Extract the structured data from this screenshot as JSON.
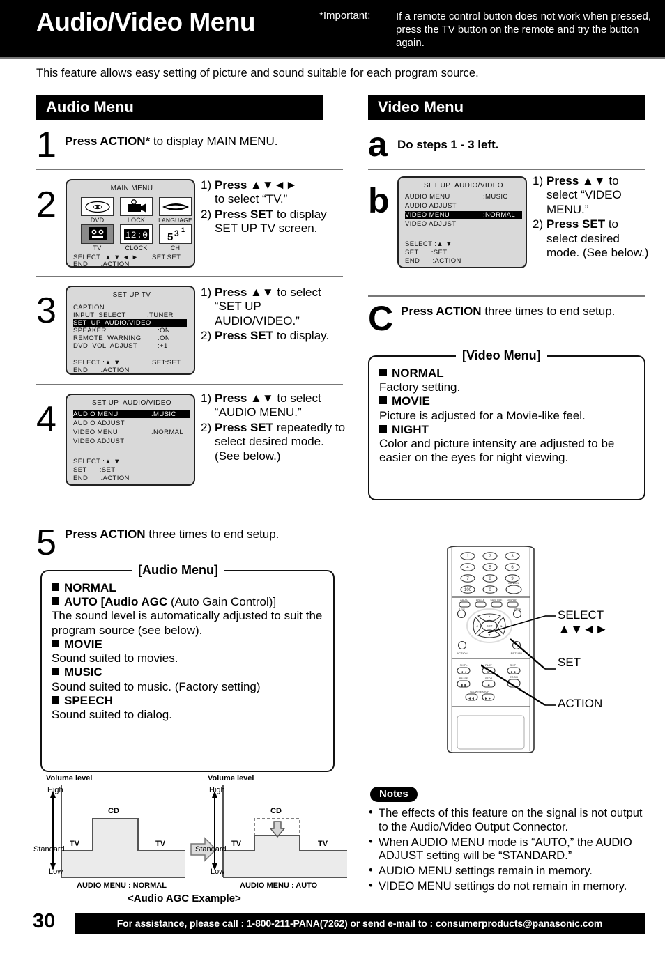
{
  "header": {
    "title": "Audio/Video Menu",
    "important_label": "*Important:",
    "important_text": "If a remote control button does not work when pressed, press the TV button on the remote and try the button again."
  },
  "intro": "This feature allows easy setting of picture and sound suitable for each program source.",
  "audio_section": {
    "bar_title": "Audio Menu",
    "step1": {
      "num": "1",
      "text_bold": "Press ACTION*",
      "text_rest": " to display MAIN MENU."
    },
    "step2": {
      "num": "2",
      "items": [
        {
          "marker": "1)",
          "bold": "Press ▲▼◄►",
          "rest": "to select “TV.”"
        },
        {
          "marker": "2)",
          "bold": "Press SET",
          "rest": " to display SET UP TV screen."
        }
      ],
      "osd": {
        "title": "MAIN MENU",
        "tiles": [
          {
            "label": "DVD",
            "icon": "disc-icon",
            "selected": false
          },
          {
            "label": "LOCK",
            "icon": "camcorder-icon",
            "selected": false
          },
          {
            "label": "LANGUAGE",
            "icon": "lips-icon",
            "selected": false
          },
          {
            "label": "TV",
            "icon": "tv-icon",
            "selected": true
          },
          {
            "label": "CLOCK",
            "icon": "clock-icon",
            "selected": false
          },
          {
            "label": "CH",
            "icon": "channel-icon",
            "selected": false
          }
        ],
        "footer_select": "SELECT :▲ ▼ ◄ ►",
        "footer_set": "SET:SET",
        "footer_end": "END      :ACTION"
      }
    },
    "step3": {
      "num": "3",
      "items": [
        {
          "marker": "1)",
          "bold": "Press ▲▼",
          "rest": " to select “SET UP AUDIO/VIDEO.”"
        },
        {
          "marker": "2)",
          "bold": "Press SET",
          "rest": " to display."
        }
      ],
      "osd": {
        "title": "SET UP TV",
        "rows": [
          {
            "label": "CAPTION",
            "value": "",
            "highlighted": false
          },
          {
            "label": "INPUT  SELECT",
            "value": ":TUNER",
            "highlighted": false
          },
          {
            "label": "SET  UP  AUDIO/VIDEO",
            "value": "",
            "highlighted": true
          },
          {
            "label": "SPEAKER",
            "value": ":ON",
            "highlighted": false
          },
          {
            "label": "REMOTE  WARNING",
            "value": ":ON",
            "highlighted": false
          },
          {
            "label": "DVD  VOL  ADJUST",
            "value": ":+1",
            "highlighted": false
          }
        ],
        "footer_select": "SELECT :▲ ▼",
        "footer_set": "SET:SET",
        "footer_end": "END      :ACTION"
      }
    },
    "step4": {
      "num": "4",
      "items": [
        {
          "marker": "1)",
          "bold": "Press ▲▼",
          "rest": " to select “AUDIO MENU.”"
        },
        {
          "marker": "2)",
          "bold": "Press SET",
          "rest": " repeatedly to select desired mode. (See below.)"
        }
      ],
      "osd": {
        "title": "SET UP  AUDIO/VIDEO",
        "rows": [
          {
            "label": "AUDIO MENU",
            "value": ":MUSIC",
            "highlighted": true
          },
          {
            "label": "AUDIO ADJUST",
            "value": "",
            "highlighted": false
          },
          {
            "label": "VIDEO MENU",
            "value": ":NORMAL",
            "highlighted": false
          },
          {
            "label": "VIDEO ADJUST",
            "value": "",
            "highlighted": false
          }
        ],
        "footer_select": "SELECT :▲ ▼",
        "footer_set2": "SET      :SET",
        "footer_end": "END      :ACTION"
      }
    },
    "step5": {
      "num": "5",
      "text_bold": "Press ACTION",
      "text_rest": " three times to end setup."
    },
    "menu_box": {
      "caption": "[Audio Menu]",
      "options": [
        {
          "name": "NORMAL",
          "desc": ""
        },
        {
          "name": "AUTO [Audio AGC",
          "name_tail": " (Auto Gain Control)]",
          "desc": "The sound level is automatically adjusted to suit the program source (see below)."
        },
        {
          "name": "MOVIE",
          "desc": "Sound suited to movies."
        },
        {
          "name": "MUSIC",
          "desc": "Sound suited to music. (Factory setting)"
        },
        {
          "name": "SPEECH",
          "desc": "Sound suited to dialog."
        }
      ]
    }
  },
  "video_section": {
    "bar_title": "Video Menu",
    "stepa": {
      "letter": "a",
      "text": "Do steps 1 - 3 left."
    },
    "stepb": {
      "letter": "b",
      "items": [
        {
          "marker": "1)",
          "bold": "Press ▲▼",
          "rest": " to select “VIDEO MENU.”"
        },
        {
          "marker": "2)",
          "bold": "Press SET",
          "rest": " to select desired mode. (See below.)"
        }
      ],
      "osd": {
        "title": "SET UP  AUDIO/VIDEO",
        "rows": [
          {
            "label": "AUDIO MENU",
            "value": ":MUSIC",
            "highlighted": false
          },
          {
            "label": "AUDIO ADJUST",
            "value": "",
            "highlighted": false
          },
          {
            "label": "VIDEO MENU",
            "value": ":NORMAL",
            "highlighted": true
          },
          {
            "label": "VIDEO ADJUST",
            "value": "",
            "highlighted": false
          }
        ],
        "footer_select": "SELECT :▲ ▼",
        "footer_set2": "SET      :SET",
        "footer_end": "END      :ACTION"
      }
    },
    "stepc": {
      "letter": "C",
      "text_bold": "Press ACTION",
      "text_rest": " three times to end setup."
    },
    "menu_box": {
      "caption": "[Video Menu]",
      "options": [
        {
          "name": "NORMAL",
          "desc": "Factory setting."
        },
        {
          "name": "MOVIE",
          "desc": "Picture is adjusted for a Movie-like feel."
        },
        {
          "name": "NIGHT",
          "desc": "Color and picture intensity are adjusted to be easier on the eyes for night viewing."
        }
      ]
    }
  },
  "remote": {
    "keypad": [
      "1",
      "2",
      "3",
      "4",
      "5",
      "6",
      "7",
      "8",
      "9",
      "100",
      "0"
    ],
    "cancel_label": "CANCEL",
    "fn_row": [
      "AUDIO",
      "ANGLE",
      "SUBTITLE",
      "DISPLAY"
    ],
    "title_label": "TITLE",
    "menu_label": "MENU",
    "action_label": "ACTION",
    "return_label": "RETURN",
    "transport": [
      "SKIP–",
      "PLAY",
      "SKIP+",
      "PAUSE",
      "STOP",
      "ZOOM",
      "SLOW/SEARCH"
    ],
    "callouts": [
      {
        "label": "SELECT",
        "sub": "▲▼◄►",
        "name": "select-callout"
      },
      {
        "label": "SET",
        "sub": "",
        "name": "set-callout"
      },
      {
        "label": "ACTION",
        "sub": "",
        "name": "action-callout"
      }
    ]
  },
  "notes": {
    "title": "Notes",
    "items": [
      "The effects of this feature on the signal is not output to the Audio/Video Output Connector.",
      "When AUDIO MENU mode is “AUTO,” the AUDIO ADJUST setting will be “STANDARD.”",
      "AUDIO MENU settings remain in memory.",
      "VIDEO MENU settings do not remain in memory."
    ]
  },
  "chart_data": {
    "type": "area",
    "title": "<Audio AGC Example>",
    "panels": [
      {
        "caption": "AUDIO MENU : NORMAL",
        "ylabel": "Volume level",
        "ytick_labels": [
          "High",
          "Standard",
          "Low"
        ],
        "segments": [
          {
            "label": "TV",
            "level": "Standard"
          },
          {
            "label": "CD",
            "level": "High"
          },
          {
            "label": "TV",
            "level": "Standard"
          }
        ],
        "values": [
          0,
          1,
          0
        ],
        "ylim": [
          -1,
          1
        ]
      },
      {
        "caption": "AUDIO MENU : AUTO",
        "ylabel": "Volume level",
        "ytick_labels": [
          "High",
          "Standard",
          "Low"
        ],
        "segments": [
          {
            "label": "TV",
            "level": "Standard"
          },
          {
            "label": "CD",
            "level": "Reduced (arrow down from dashed High)"
          },
          {
            "label": "TV",
            "level": "Standard"
          }
        ],
        "values": [
          0,
          0.35,
          0
        ],
        "dashed_reference": 1,
        "ylim": [
          -1,
          1
        ]
      }
    ],
    "transition_arrow": "⇒"
  },
  "footer": {
    "page_number": "30",
    "text": "For assistance, please call : 1-800-211-PANA(7262) or send e-mail to : consumerproducts@panasonic.com"
  }
}
